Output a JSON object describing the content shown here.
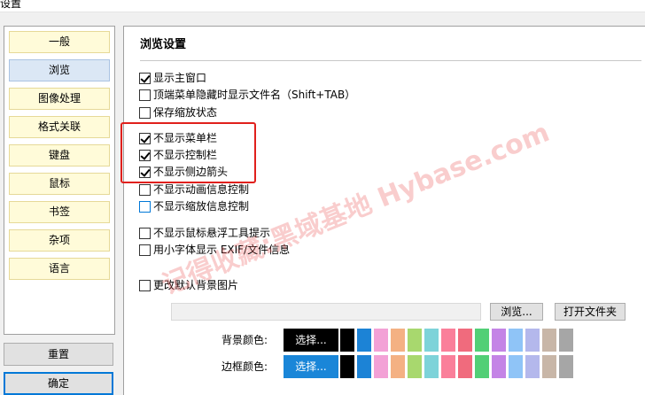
{
  "window": {
    "title": "设置"
  },
  "sidebar": {
    "items": [
      {
        "label": "一般",
        "active": false
      },
      {
        "label": "浏览",
        "active": true
      },
      {
        "label": "图像处理",
        "active": false
      },
      {
        "label": "格式关联",
        "active": false
      },
      {
        "label": "键盘",
        "active": false
      },
      {
        "label": "鼠标",
        "active": false
      },
      {
        "label": "书签",
        "active": false
      },
      {
        "label": "杂项",
        "active": false
      },
      {
        "label": "语言",
        "active": false
      }
    ]
  },
  "footer": {
    "reset_label": "重置",
    "ok_label": "确定"
  },
  "section": {
    "title": "浏览设置"
  },
  "options": [
    {
      "label": "显示主窗口",
      "checked": true
    },
    {
      "label": "顶端菜单隐藏时显示文件名（Shift+TAB）",
      "checked": false
    },
    {
      "label": "保存缩放状态",
      "checked": false
    },
    {
      "label": "不显示菜单栏",
      "checked": true
    },
    {
      "label": "不显示控制栏",
      "checked": true
    },
    {
      "label": "不显示侧边箭头",
      "checked": true
    },
    {
      "label": "不显示动画信息控制",
      "checked": false
    },
    {
      "label": "不显示缩放信息控制",
      "checked": false
    },
    {
      "label": "不显示鼠标悬浮工具提示",
      "checked": false
    },
    {
      "label": "用小字体显示 EXIF/文件信息",
      "checked": false
    },
    {
      "label": "更改默认背景图片",
      "checked": false
    }
  ],
  "background_image": {
    "path_value": "",
    "browse_label": "浏览...",
    "open_folder_label": "打开文件夹"
  },
  "colors": {
    "background_label": "背景颜色:",
    "border_label": "边框颜色:",
    "select_label": "选择...",
    "background_selected": "#000000",
    "border_selected": "#1a86d8",
    "swatches": [
      "#000000",
      "#1c83d6",
      "#f3a1d6",
      "#f4b183",
      "#a8d86e",
      "#7dd3d9",
      "#fa7f9a",
      "#f06b7d",
      "#52cf76",
      "#c484e6",
      "#8fc4f7",
      "#b4b8ec",
      "#c8b6a7",
      "#a6a6a6"
    ]
  },
  "watermark": {
    "text": "记得收藏:黑域基地 Hybase.com"
  }
}
